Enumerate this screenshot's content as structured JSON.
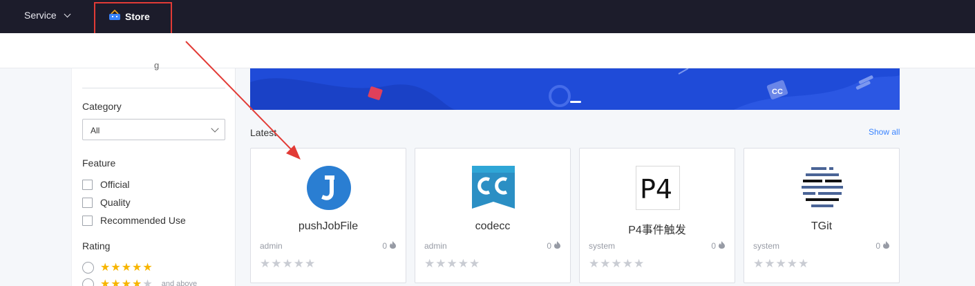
{
  "nav": {
    "service_label": "Service",
    "store_label": "Store"
  },
  "sidebar": {
    "search_partial": "g",
    "category_heading": "Category",
    "category_value": "All",
    "feature_heading": "Feature",
    "features": [
      "Official",
      "Quality",
      "Recommended Use"
    ],
    "rating_heading": "Rating",
    "ratings": [
      {
        "stars": 5,
        "extra": ""
      },
      {
        "stars": 4,
        "extra": "and above"
      }
    ]
  },
  "main": {
    "latest_heading": "Latest",
    "show_all": "Show all",
    "cards": [
      {
        "name": "pushJobFile",
        "author": "admin",
        "count": "0",
        "rating": 0,
        "icon": "j-logo-icon",
        "color": "#2a7ed2"
      },
      {
        "name": "codecc",
        "author": "admin",
        "count": "0",
        "rating": 0,
        "icon": "codecc-logo-icon",
        "color": "#2b8fc4"
      },
      {
        "name": "P4事件触发",
        "author": "system",
        "count": "0",
        "rating": 0,
        "icon": "p4-logo-icon",
        "color": "#111111"
      },
      {
        "name": "TGit",
        "author": "system",
        "count": "0",
        "rating": 0,
        "icon": "tgit-logo-icon",
        "color": "#4a6496"
      }
    ]
  },
  "colors": {
    "topbar": "#1c1c2b",
    "highlight": "#e23b36",
    "banner": "#1f4bd8",
    "link": "#3a84ff",
    "star_on": "#f7b500",
    "star_off": "#c9ccd3"
  }
}
